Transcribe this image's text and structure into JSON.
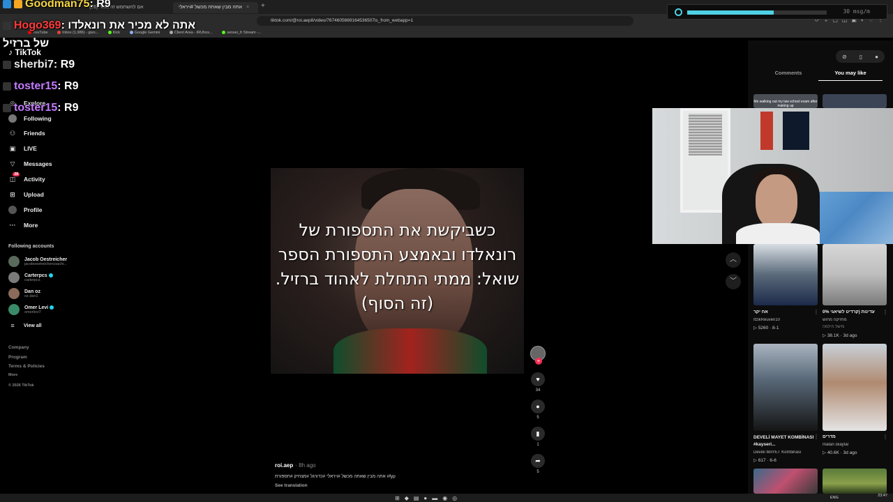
{
  "browser": {
    "tabs": [
      {
        "label": "(26) אם להשתמש זה מגזר",
        "active": false
      },
      {
        "label": "אתה מבין שאתה מכשל #ויראלי",
        "active": true
      }
    ],
    "url": "tiktok.com/@roi.aep8/video/7674605669164536507is_from_webapp=1",
    "bookmarks": [
      "YouTube",
      "Inbox (1,986) - givo...",
      "Kick",
      "Google Gemini",
      "Client Area - IRUhos...",
      "sensei_fr Stream -..."
    ]
  },
  "stream_chat": [
    {
      "user": "Goodman75",
      "msg": ": R9",
      "color": "#f5d442"
    },
    {
      "user": "Hogo369",
      "msg": ": אתה לא מכיר את רונאלדו",
      "color": "#ff3b3b"
    },
    {
      "user": "",
      "msg": "של ברזיל",
      "color": "#ffffff"
    },
    {
      "user": "sherbi7",
      "msg": ": R9",
      "color": "#e8e8e8"
    },
    {
      "user": "toster15",
      "msg": ": R9",
      "color": "#c57bff"
    },
    {
      "user": "toster15",
      "msg": ": R9",
      "color": "#c57bff"
    }
  ],
  "music_widget": {
    "label": "30 msg/m",
    "level": 0.62
  },
  "sidebar": {
    "logo": "TikTok",
    "nav": [
      {
        "label": "Explore",
        "icon": "compass-icon"
      },
      {
        "label": "Following",
        "icon": "following-avatar-icon"
      },
      {
        "label": "Friends",
        "icon": "friends-icon"
      },
      {
        "label": "LIVE",
        "icon": "live-icon"
      },
      {
        "label": "Messages",
        "icon": "send-icon"
      },
      {
        "label": "Activity",
        "icon": "activity-icon",
        "badge": "38"
      },
      {
        "label": "Upload",
        "icon": "upload-icon"
      },
      {
        "label": "Profile",
        "icon": "profile-avatar-icon"
      },
      {
        "label": "More",
        "icon": "more-icon"
      }
    ],
    "following_title": "Following accounts",
    "accounts": [
      {
        "name": "Jacob Oestreicher",
        "handle": "jacoboestreichercoachi...",
        "verified": false,
        "color": "#5a6a5a"
      },
      {
        "name": "Carterpcs",
        "handle": "carterpcs",
        "verified": true,
        "color": "#7a7a7a"
      },
      {
        "name": "Dan oz",
        "handle": "oz.dan1",
        "verified": false,
        "color": "#8a6a5a"
      },
      {
        "name": "Omer Levi",
        "handle": "omerlevi7",
        "verified": true,
        "color": "#3a8a6a"
      }
    ],
    "view_all": "View all",
    "footer": [
      "Company",
      "Program",
      "Terms & Policies",
      "More",
      "© 2026 TikTok"
    ]
  },
  "video": {
    "caption": "כשביקשת את התספורת של רונאלדו ובאמצע התספורת הספר שואל: ממתי התחלת לאהוד ברזיל.(זה הסוף)",
    "author": "roi.aep",
    "time": "· 8h ago",
    "description": "אתה מבין שאתה מכשל #ויראלי #כדורגל #מצחיק #תספורת #fyp",
    "see_translation": "See translation",
    "likes": "34",
    "comments": "5",
    "saves": "1",
    "shares": "5"
  },
  "right_panel": {
    "tabs": [
      "Comments",
      "You may like"
    ],
    "thumb_top_text": "Me walking out my law school exam after making up",
    "suggested": [
      {
        "title": "אח יקר",
        "author": "ItzikReuven10",
        "stats": "5260 · 8-1",
        "color1": "#5a6a7a",
        "color2": "#2a3a5a"
      },
      {
        "title": "0% עדינות (קרדיט לשיאגי",
        "author": "מחזיקה מחוש",
        "author2": "מישל הילמה",
        "stats": "38.1K · 3d ago",
        "color1": "#cfcfcf",
        "color2": "#6a6a6a"
      },
      {
        "title": "DEVELİ MAYET KOMBİNASI #kayseri...",
        "author": "Develi MAYET Kombinası",
        "stats": "617 · 6-6",
        "color1": "#5a6a7a",
        "color2": "#1a1a1a"
      },
      {
        "title": "מדרים",
        "author": "matan skaytal",
        "stats": "40.6K · 3d ago",
        "color1": "#c0c8d0",
        "color2": "#a07a60"
      }
    ]
  },
  "taskbar": {
    "lang": "ENG",
    "time": "23:47"
  }
}
